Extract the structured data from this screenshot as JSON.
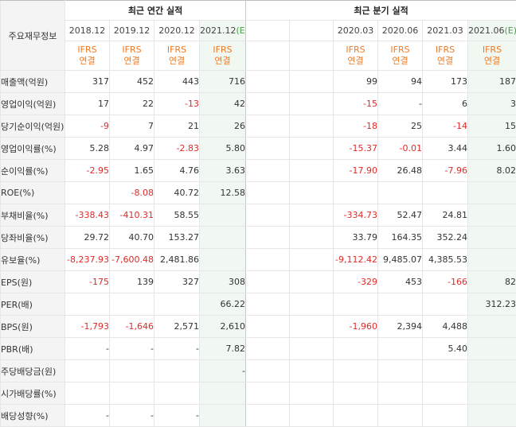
{
  "table": {
    "corner_label": "주요재무정보",
    "annual_header": "최근 연간 실적",
    "quarter_header": "최근 분기 실적",
    "annual_periods": [
      "2018.12",
      "2019.12",
      "2020.12",
      "2021.12"
    ],
    "quarter_periods": [
      "",
      "",
      "2020.03",
      "2020.06",
      "2021.03",
      "2021.06"
    ],
    "estimate_mark": "(E)",
    "ifrs_line1": "IFRS",
    "ifrs_line2": "연결",
    "rows": [
      {
        "label": "매출액(억원)",
        "values": [
          "317",
          "452",
          "443",
          "716",
          "",
          "",
          "99",
          "94",
          "173",
          "187"
        ]
      },
      {
        "label": "영업이익(억원)",
        "values": [
          "17",
          "22",
          "-13",
          "42",
          "",
          "",
          "-15",
          "-",
          "6",
          "3"
        ]
      },
      {
        "label": "당기순이익(억원)",
        "values": [
          "-9",
          "7",
          "21",
          "26",
          "",
          "",
          "-18",
          "25",
          "-14",
          "15"
        ]
      },
      {
        "label": "영업이익률(%)",
        "values": [
          "5.28",
          "4.97",
          "-2.83",
          "5.80",
          "",
          "",
          "-15.37",
          "-0.01",
          "3.44",
          "1.60"
        ]
      },
      {
        "label": "순이익률(%)",
        "values": [
          "-2.95",
          "1.65",
          "4.76",
          "3.63",
          "",
          "",
          "-17.90",
          "26.48",
          "-7.96",
          "8.02"
        ]
      },
      {
        "label": "ROE(%)",
        "values": [
          "",
          "-8.08",
          "40.72",
          "12.58",
          "",
          "",
          "",
          "",
          "",
          ""
        ]
      },
      {
        "label": "부채비율(%)",
        "values": [
          "-338.43",
          "-410.31",
          "58.55",
          "",
          "",
          "",
          "-334.73",
          "52.47",
          "24.81",
          ""
        ]
      },
      {
        "label": "당좌비율(%)",
        "values": [
          "29.72",
          "40.70",
          "153.27",
          "",
          "",
          "",
          "33.79",
          "164.35",
          "352.24",
          ""
        ]
      },
      {
        "label": "유보율(%)",
        "values": [
          "-8,237.93",
          "-7,600.48",
          "2,481.86",
          "",
          "",
          "",
          "-9,112.42",
          "9,485.07",
          "4,385.53",
          ""
        ]
      },
      {
        "label": "EPS(원)",
        "values": [
          "-175",
          "139",
          "327",
          "308",
          "",
          "",
          "-329",
          "453",
          "-166",
          "82"
        ]
      },
      {
        "label": "PER(배)",
        "values": [
          "",
          "",
          "",
          "66.22",
          "",
          "",
          "",
          "",
          "",
          "312.23"
        ]
      },
      {
        "label": "BPS(원)",
        "values": [
          "-1,793",
          "-1,646",
          "2,571",
          "2,610",
          "",
          "",
          "-1,960",
          "2,394",
          "4,488",
          ""
        ]
      },
      {
        "label": "PBR(배)",
        "values": [
          "-",
          "-",
          "-",
          "7.82",
          "",
          "",
          "",
          "",
          "5.40",
          ""
        ]
      },
      {
        "label": "주당배당금(원)",
        "values": [
          "",
          "",
          "",
          "-",
          "",
          "",
          "",
          "",
          "",
          ""
        ]
      },
      {
        "label": "시가배당률(%)",
        "values": [
          "",
          "",
          "",
          "",
          "",
          "",
          "",
          "",
          "",
          ""
        ]
      },
      {
        "label": "배당성향(%)",
        "values": [
          "-",
          "-",
          "-",
          "",
          "",
          "",
          "",
          "",
          "",
          ""
        ]
      }
    ]
  }
}
